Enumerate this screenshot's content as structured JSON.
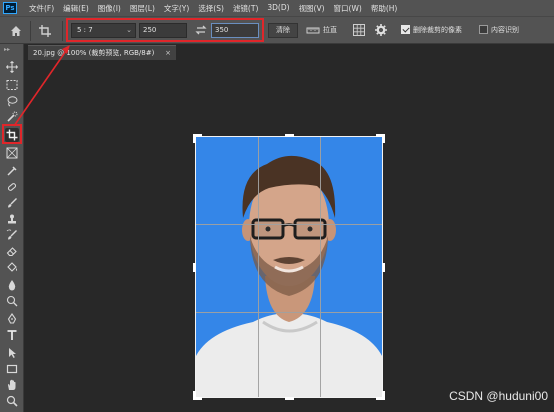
{
  "app": {
    "logo_text": "Ps"
  },
  "menu": [
    "文件(F)",
    "编辑(E)",
    "图像(I)",
    "图层(L)",
    "文字(Y)",
    "选择(S)",
    "滤镜(T)",
    "3D(D)",
    "视图(V)",
    "窗口(W)",
    "帮助(H)"
  ],
  "options": {
    "ratio_value": "5 : 7",
    "width_value": "250",
    "height_value": "350",
    "clear_label": "清除",
    "straighten_label": "拉直",
    "delete_cropped_label": "删除裁剪的像素",
    "delete_cropped_checked": true,
    "content_aware_label": "内容识别",
    "content_aware_checked": false
  },
  "document": {
    "tab_title": "20.jpg @ 100% (裁剪预览, RGB/8#)",
    "close_glyph": "×"
  },
  "tools": [
    "move-tool",
    "marquee-tool",
    "lasso-tool",
    "quick-select-tool",
    "crop-tool",
    "frame-tool",
    "eyedropper-tool",
    "healing-brush-tool",
    "brush-tool",
    "clone-stamp-tool",
    "history-brush-tool",
    "eraser-tool",
    "paint-bucket-tool",
    "blur-tool",
    "dodge-tool",
    "pen-tool",
    "type-tool",
    "path-select-tool",
    "rectangle-tool",
    "hand-tool",
    "zoom-tool"
  ],
  "colors": {
    "accent_red": "#e0262a",
    "photo_background": "#3486e8"
  },
  "watermark": "CSDN @huduni00"
}
